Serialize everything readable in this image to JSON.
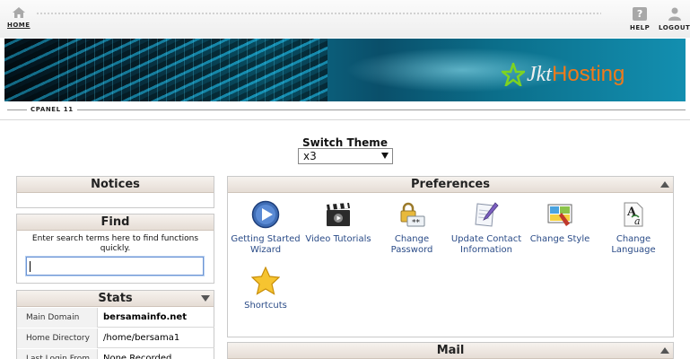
{
  "topbar": {
    "home_label": "HOME",
    "help_label": "HELP",
    "logout_label": "LOGOUT"
  },
  "banner": {
    "logo_part1": "Jkt",
    "logo_part2": "Hosting",
    "brand_colors": {
      "orange": "#f07a1a",
      "teal": "#0d6f8c",
      "star_green": "#7ed321"
    }
  },
  "cpanel_label": "CPANEL 11",
  "switch_theme": {
    "title": "Switch Theme",
    "selected": "x3"
  },
  "notices": {
    "title": "Notices"
  },
  "find": {
    "title": "Find",
    "description": "Enter search terms here to find functions quickly.",
    "value": ""
  },
  "stats": {
    "title": "Stats",
    "rows": [
      {
        "label": "Main Domain",
        "value": "bersamainfo.net"
      },
      {
        "label": "Home Directory",
        "value": "/home/bersama1"
      },
      {
        "label": "Last Login From",
        "value": "None Recorded"
      }
    ]
  },
  "preferences": {
    "title": "Preferences",
    "items": [
      {
        "label": "Getting Started Wizard",
        "icon": "play-icon"
      },
      {
        "label": "Video Tutorials",
        "icon": "clapperboard-icon"
      },
      {
        "label": "Change Password",
        "icon": "lock-icon"
      },
      {
        "label": "Update Contact Information",
        "icon": "contact-edit-icon"
      },
      {
        "label": "Change Style",
        "icon": "style-icon"
      },
      {
        "label": "Change Language",
        "icon": "language-icon"
      },
      {
        "label": "Shortcuts",
        "icon": "star-icon"
      }
    ]
  },
  "mail": {
    "title": "Mail"
  }
}
